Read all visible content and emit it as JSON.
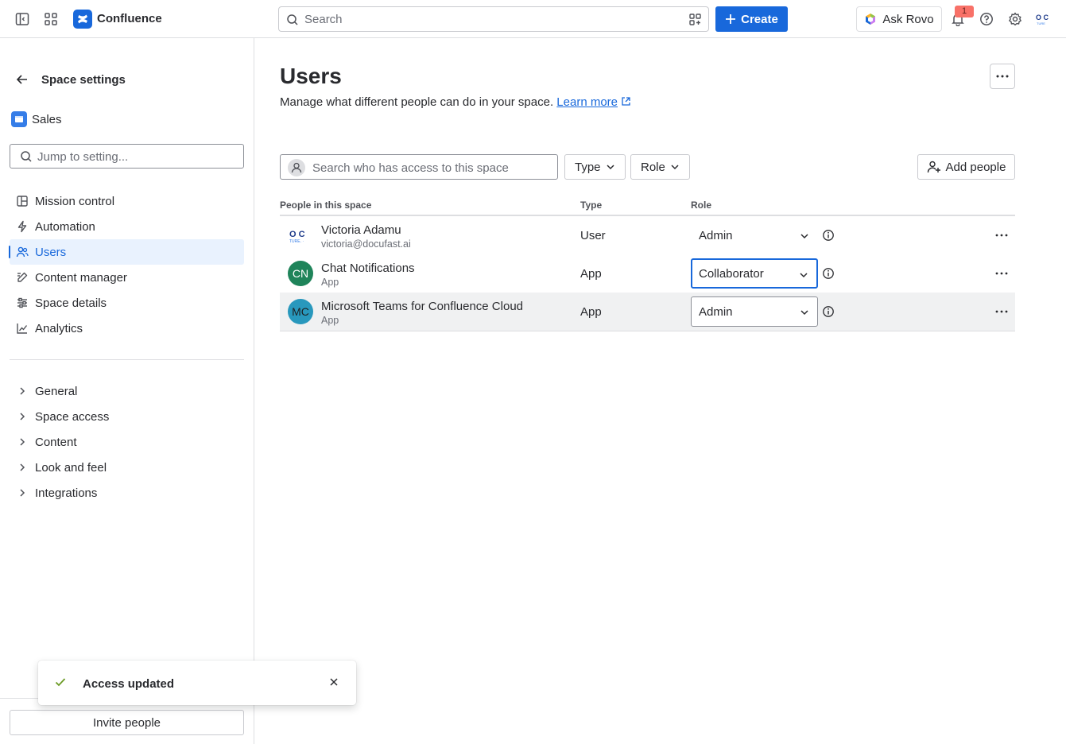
{
  "topbar": {
    "brand": "Confluence",
    "search_placeholder": "Search",
    "create_label": "Create",
    "rovo_label": "Ask Rovo",
    "notification_count": "1"
  },
  "sidebar": {
    "title": "Space settings",
    "space_name": "Sales",
    "jump_placeholder": "Jump to setting...",
    "items": [
      {
        "label": "Mission control",
        "icon": "layout-icon"
      },
      {
        "label": "Automation",
        "icon": "lightning-icon"
      },
      {
        "label": "Users",
        "icon": "people-icon",
        "active": true
      },
      {
        "label": "Content manager",
        "icon": "edit-icon"
      },
      {
        "label": "Space details",
        "icon": "sliders-icon"
      },
      {
        "label": "Analytics",
        "icon": "chart-icon"
      }
    ],
    "groups": [
      "General",
      "Space access",
      "Content",
      "Look and feel",
      "Integrations"
    ],
    "invite_label": "Invite people"
  },
  "toast": {
    "message": "Access updated",
    "accent": "#6a9a23"
  },
  "main": {
    "title": "Users",
    "subtitle": "Manage what different people can do in your space.",
    "learn_more": "Learn more",
    "filter_placeholder": "Search who has access to this space",
    "type_filter": "Type",
    "role_filter": "Role",
    "add_people": "Add people",
    "columns": {
      "people": "People in this space",
      "type": "Type",
      "role": "Role"
    },
    "rows": [
      {
        "name": "Victoria Adamu",
        "sub": "victoria@docufast.ai",
        "type": "User",
        "role": "Admin",
        "avatar": "logo"
      },
      {
        "name": "Chat Notifications",
        "sub": "App",
        "type": "App",
        "role": "Collaborator",
        "avatar": "CN",
        "avatar_color": "#1f845a"
      },
      {
        "name": "Microsoft Teams for Confluence Cloud",
        "sub": "App",
        "type": "App",
        "role": "Admin",
        "avatar": "MC",
        "avatar_color": "#2898bd"
      }
    ]
  },
  "colors": {
    "accent": "#1868db",
    "active_bg": "#e9f2fe"
  }
}
